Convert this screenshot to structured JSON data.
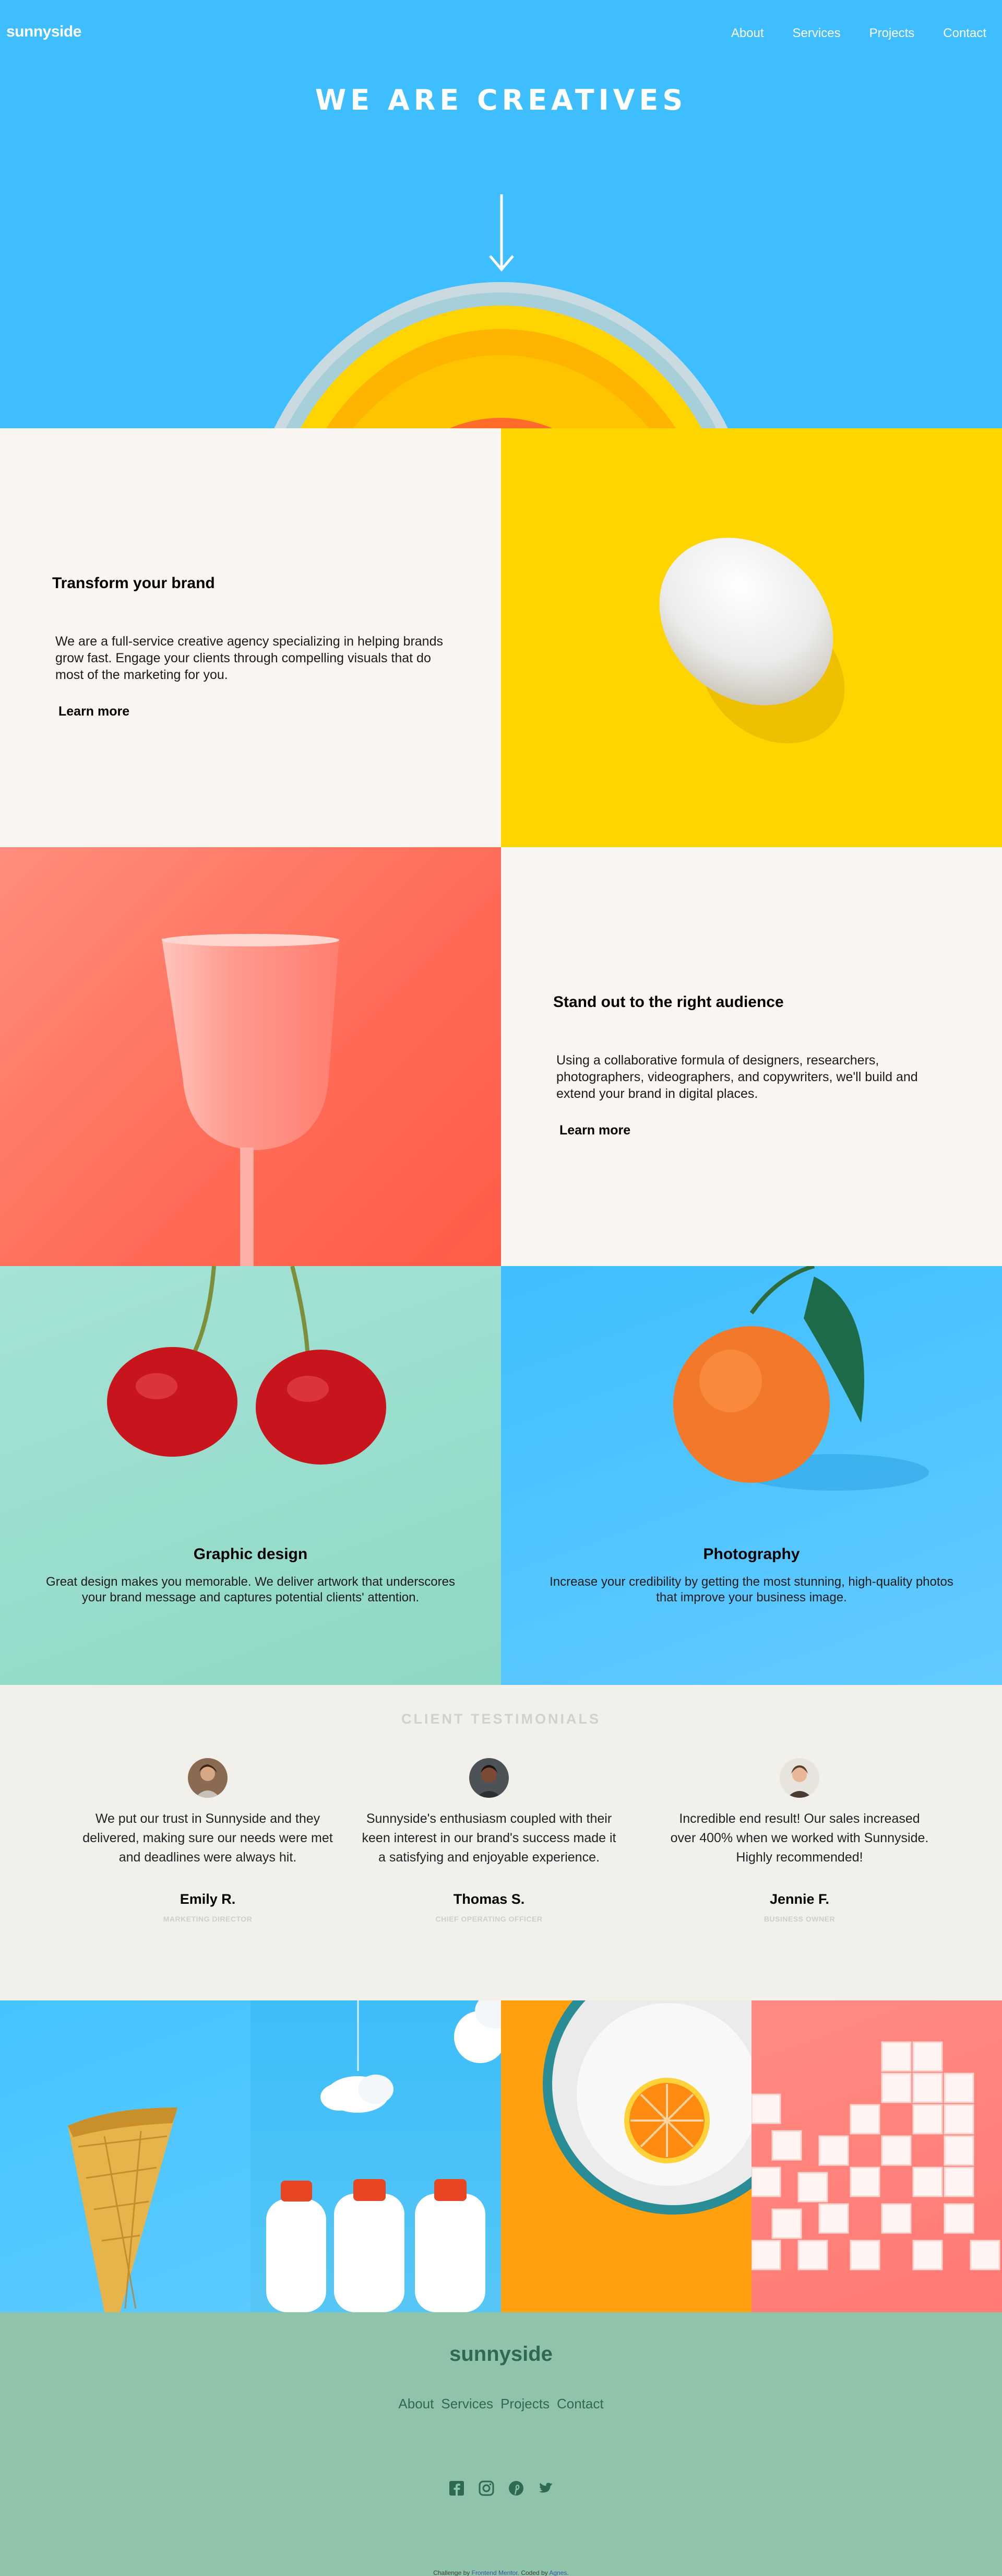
{
  "header": {
    "logo": "sunnyside",
    "nav": [
      "About",
      "Services",
      "Projects",
      "Contact"
    ]
  },
  "hero": {
    "title": "WE ARE CREATIVES",
    "arrow_icon": "arrow-down-icon"
  },
  "features": [
    {
      "title": "Transform your brand",
      "body": "We are a full-service creative agency specializing in helping brands grow fast. Engage your clients through compelling visuals that do most of the marketing for you.",
      "link": "Learn more",
      "image": "egg"
    },
    {
      "title": "Stand out to the right audience",
      "body": "Using a collaborative formula of designers, researchers, photographers, videographers, and copywriters, we'll build and extend your brand in digital places.",
      "link": "Learn more",
      "image": "glass"
    }
  ],
  "services": [
    {
      "title": "Graphic design",
      "body": "Great design makes you memorable. We deliver artwork that underscores your brand message and captures potential clients' attention.",
      "image": "cherries"
    },
    {
      "title": "Photography",
      "body": "Increase your credibility by getting the most stunning, high-quality photos that improve your business image.",
      "image": "orange"
    }
  ],
  "testimonials": {
    "heading": "CLIENT TESTIMONIALS",
    "items": [
      {
        "quote": "We put our trust in Sunnyside and they delivered, making sure our needs were met and deadlines were always hit.",
        "name": "Emily R.",
        "role": "MARKETING DIRECTOR"
      },
      {
        "quote": "Sunnyside's enthusiasm coupled with their keen interest in our brand's success made it a satisfying and enjoyable experience.",
        "name": "Thomas S.",
        "role": "CHIEF OPERATING OFFICER"
      },
      {
        "quote": "Incredible end result! Our sales increased over 400% when we worked with Sunnyside. Highly recommended!",
        "name": "Jennie F.",
        "role": "BUSINESS OWNER"
      }
    ]
  },
  "gallery": [
    "cone",
    "milk-bottles",
    "orange-plate",
    "sugar-cubes"
  ],
  "footer": {
    "logo": "sunnyside",
    "nav": [
      "About",
      "Services",
      "Projects",
      "Contact"
    ],
    "social": [
      "facebook-icon",
      "instagram-icon",
      "pinterest-icon",
      "twitter-icon"
    ],
    "credit_prefix": "Challenge by ",
    "credit_link1": "Frontend Mentor",
    "credit_middle": ". Coded by ",
    "credit_link2": "Agnes",
    "credit_suffix": "."
  },
  "colors": {
    "hero_blue": "#3fbeff",
    "egg_yellow": "#ffd500",
    "glass_coral": "#ff6a55",
    "cherry_mint": "#a5e3d7",
    "testimonial_bg": "#f1f0ea",
    "footer_green": "#8fc4aa",
    "footer_text": "#2d6953"
  }
}
